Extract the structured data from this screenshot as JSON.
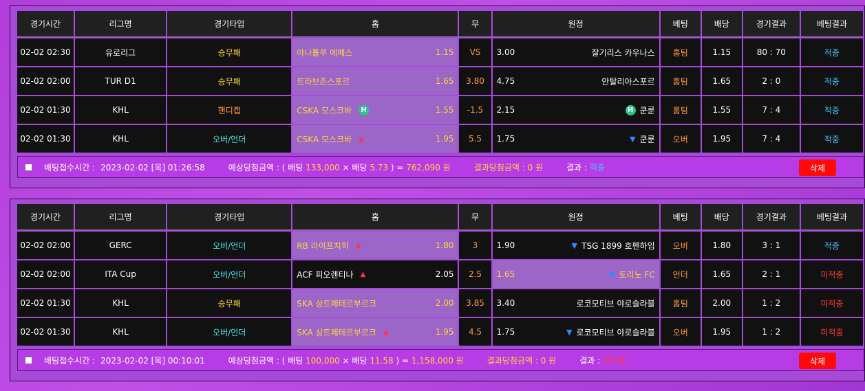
{
  "headers": [
    "경기시간",
    "리그명",
    "경기타입",
    "홈",
    "무",
    "원정",
    "베팅",
    "배당",
    "경기결과",
    "베팅결과"
  ],
  "slips": [
    {
      "rows": [
        {
          "time": "02-02 02:30",
          "league": "유로리그",
          "type": "승무패",
          "type_color": "yellow",
          "home": "아나톨루 에페스",
          "home_odds": "1.15",
          "home_mark": "",
          "draw": "VS",
          "away": "잘기리스 카우나스",
          "away_odds": "3.00",
          "away_mark": "",
          "pick": "home",
          "bet": "홈팀",
          "bet_odds": "1.15",
          "score": "80 : 70",
          "result": "적중",
          "result_color": "blue"
        },
        {
          "time": "02-02 02:00",
          "league": "TUR D1",
          "type": "승무패",
          "type_color": "yellow",
          "home": "트라브존스포르",
          "home_odds": "1.65",
          "home_mark": "",
          "draw": "3.80",
          "away": "안탈리아스포르",
          "away_odds": "4.75",
          "away_mark": "",
          "pick": "home",
          "bet": "홈팀",
          "bet_odds": "1.65",
          "score": "2 : 0",
          "result": "적중",
          "result_color": "blue"
        },
        {
          "time": "02-02 01:30",
          "league": "KHL",
          "type": "핸디캡",
          "type_color": "orange",
          "home": "CSKA 모스크바",
          "home_odds": "1.55",
          "home_mark": "H",
          "draw": "-1.5",
          "away": "쿤룬",
          "away_odds": "2.15",
          "away_mark": "H",
          "pick": "home",
          "bet": "홈팀",
          "bet_odds": "1.55",
          "score": "7 : 4",
          "result": "적중",
          "result_color": "blue"
        },
        {
          "time": "02-02 01:30",
          "league": "KHL",
          "type": "오버/언더",
          "type_color": "teal",
          "home": "CSKA 모스크바",
          "home_odds": "1.95",
          "home_mark": "up",
          "draw": "5.5",
          "away": "쿤룬",
          "away_odds": "1.75",
          "away_mark": "down",
          "pick": "home",
          "bet": "오버",
          "bet_odds": "1.95",
          "score": "7 : 4",
          "result": "적중",
          "result_color": "blue"
        }
      ],
      "footer": {
        "time_label": "배팅접수시간 :",
        "time_value": "2023-02-02 [목] 01:26:58",
        "expect_label": "예상당첨금액 : ( 배팅 ",
        "bet_amount": "133,000",
        "mult": " × 배당 ",
        "total_odds": "5.73",
        "eq": " ) = ",
        "payout": "762,090 원",
        "win_label": "결과당첨금액 : ",
        "win_value": "0 원",
        "result_label": "결과 : ",
        "result_value": "적중",
        "result_color": "blue",
        "delete_label": "삭제"
      }
    },
    {
      "rows": [
        {
          "time": "02-02 02:00",
          "league": "GERC",
          "type": "오버/언더",
          "type_color": "teal",
          "home": "RB 라이프치히",
          "home_odds": "1.80",
          "home_mark": "up",
          "draw": "3",
          "away": "TSG 1899 호펜하임",
          "away_odds": "1.90",
          "away_mark": "down",
          "pick": "home",
          "bet": "오버",
          "bet_odds": "1.80",
          "score": "3 : 1",
          "result": "적중",
          "result_color": "blue"
        },
        {
          "time": "02-02 02:00",
          "league": "ITA Cup",
          "type": "오버/언더",
          "type_color": "teal",
          "home": "ACF 피오렌티나",
          "home_odds": "2.05",
          "home_mark": "up",
          "draw": "2.5",
          "away": "토리노 FC",
          "away_odds": "1.65",
          "away_mark": "down",
          "pick": "away",
          "bet": "언더",
          "bet_odds": "1.65",
          "score": "2 : 1",
          "result": "미적중",
          "result_color": "red"
        },
        {
          "time": "02-02 01:30",
          "league": "KHL",
          "type": "승무패",
          "type_color": "yellow",
          "home": "SKA 상트페테르부르크",
          "home_odds": "2.00",
          "home_mark": "",
          "draw": "3.85",
          "away": "로코모티브 야로슬라블",
          "away_odds": "3.40",
          "away_mark": "",
          "pick": "home",
          "bet": "홈팀",
          "bet_odds": "2.00",
          "score": "1 : 2",
          "result": "미적중",
          "result_color": "red"
        },
        {
          "time": "02-02 01:30",
          "league": "KHL",
          "type": "오버/언더",
          "type_color": "teal",
          "home": "SKA 상트페테르부르크",
          "home_odds": "1.95",
          "home_mark": "up",
          "draw": "4.5",
          "away": "로코모티브 야로슬라블",
          "away_odds": "1.75",
          "away_mark": "down",
          "pick": "home",
          "bet": "오버",
          "bet_odds": "1.95",
          "score": "1 : 2",
          "result": "미적중",
          "result_color": "red"
        }
      ],
      "footer": {
        "time_label": "배팅접수시간 :",
        "time_value": "2023-02-02 [목] 00:10:01",
        "expect_label": "예상당첨금액 : ( 배팅 ",
        "bet_amount": "100,000",
        "mult": " × 배당 ",
        "total_odds": "11.58",
        "eq": " ) = ",
        "payout": "1,158,000 원",
        "win_label": "결과당첨금액 : ",
        "win_value": "0 원",
        "result_label": "결과 : ",
        "result_value": "미적중",
        "result_color": "red",
        "delete_label": "삭제"
      }
    }
  ],
  "colors": {
    "yellow": "#ffd33a",
    "orange": "#ff9a3c",
    "teal": "#4de3e3",
    "blue": "#4dc0ff",
    "red": "#ff3a3a",
    "pick_bg": "#9b66c8"
  }
}
